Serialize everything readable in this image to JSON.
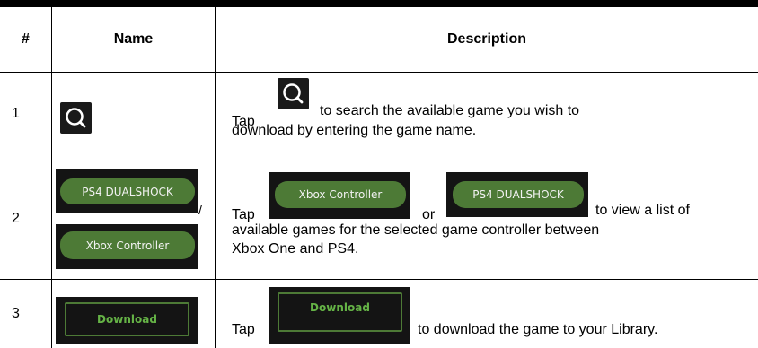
{
  "table": {
    "headers": {
      "number": "#",
      "name": "Name",
      "description": "Description"
    },
    "rows": [
      {
        "number": "1",
        "name_icon": "search-icon",
        "desc_tap": "Tap",
        "desc_line1": "to search the available game you wish to",
        "desc_line2": "download by entering the game name."
      },
      {
        "number": "2",
        "name_button_1": "PS4 DUALSHOCK",
        "name_separator": "/",
        "name_button_2": "Xbox Controller",
        "desc_tap": "Tap",
        "desc_button_xbox": "Xbox Controller",
        "desc_or": "or",
        "desc_button_ps4": "PS4 DUALSHOCK",
        "desc_line1_end": "to view a list of",
        "desc_line2": "available games for the selected game controller between",
        "desc_line3": "Xbox One and PS4."
      },
      {
        "number": "3",
        "name_button": "Download",
        "desc_tap": "Tap",
        "desc_button": "Download",
        "desc_end": "to download the game to your Library."
      }
    ]
  },
  "colors": {
    "button_green": "#4d7a36",
    "download_text_green": "#65b346",
    "icon_background": "#1a1a1a"
  }
}
